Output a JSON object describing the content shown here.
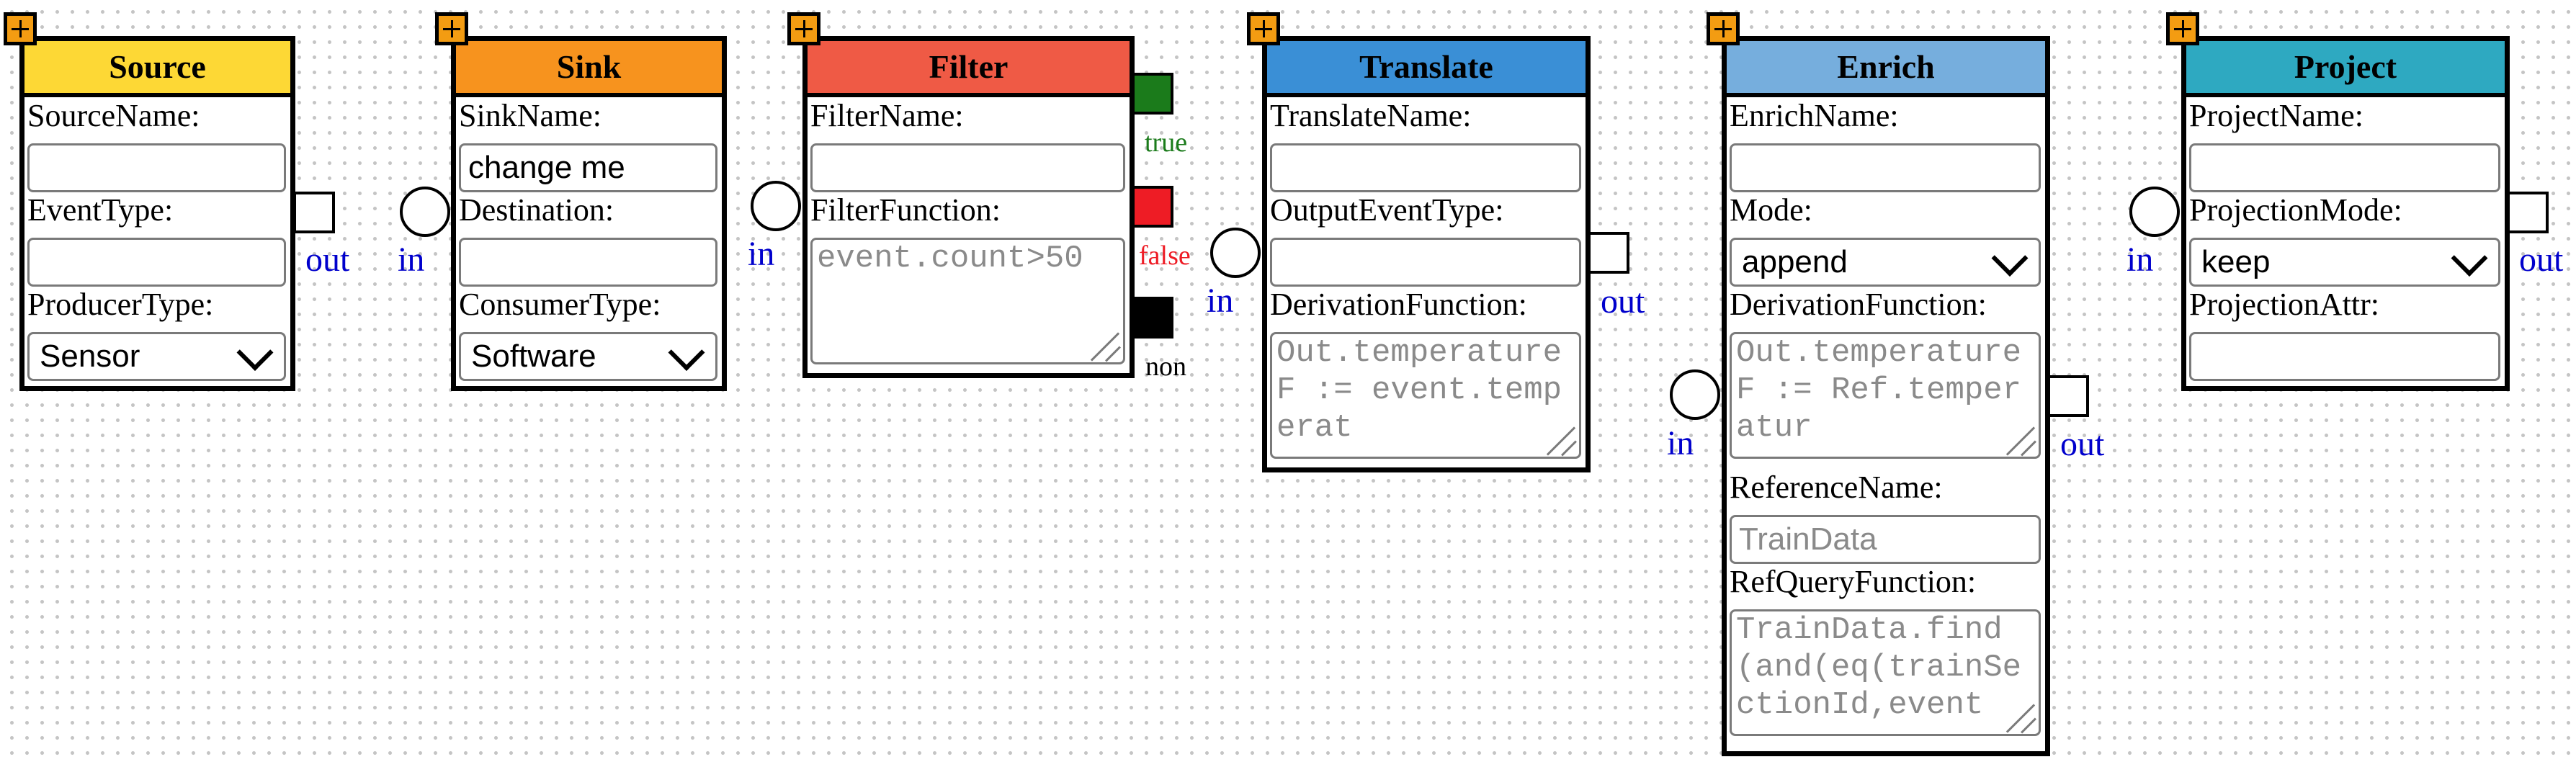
{
  "colors": {
    "source": "#fdd835",
    "sink": "#f7931e",
    "filter": "#ef5a45",
    "translate": "#3a8fd6",
    "enrich": "#76aedd",
    "project": "#2ea9c1",
    "port_label": "#0000cc",
    "true": "#1b7b1b",
    "false": "#ee1c25",
    "non": "#000000",
    "plus": "#f39c12"
  },
  "icons": [
    "plus-icon",
    "chevron-down-icon",
    "resize-grip-icon"
  ],
  "nodes": {
    "source": {
      "title": "Source",
      "labels": {
        "name": "SourceName:",
        "event_type": "EventType:",
        "producer_type": "ProducerType:"
      },
      "values": {
        "name": "",
        "event_type": "",
        "producer_type": "Sensor"
      },
      "ports": {
        "out": "out"
      }
    },
    "sink": {
      "title": "Sink",
      "labels": {
        "name": "SinkName:",
        "destination": "Destination:",
        "consumer_type": "ConsumerType:"
      },
      "values": {
        "name": "change me",
        "destination": "",
        "consumer_type": "Software"
      },
      "ports": {
        "in": "in"
      }
    },
    "filter": {
      "title": "Filter",
      "labels": {
        "name": "FilterName:",
        "function": "FilterFunction:"
      },
      "values": {
        "name": ""
      },
      "placeholders": {
        "function": "event.count>50"
      },
      "ports": {
        "in": "in",
        "true": "true",
        "false": "false",
        "non": "non"
      }
    },
    "translate": {
      "title": "Translate",
      "labels": {
        "name": "TranslateName:",
        "output_event_type": "OutputEventType:",
        "derivation": "DerivationFunction:"
      },
      "values": {
        "name": "",
        "output_event_type": ""
      },
      "placeholders": {
        "derivation": "Out.temperatureF := event.temperat"
      },
      "ports": {
        "in": "in",
        "out": "out"
      }
    },
    "enrich": {
      "title": "Enrich",
      "labels": {
        "name": "EnrichName:",
        "mode": "Mode:",
        "derivation": "DerivationFunction:",
        "reference_name": "ReferenceName:",
        "ref_query": "RefQueryFunction:"
      },
      "values": {
        "name": "",
        "mode": "append"
      },
      "placeholders": {
        "derivation": "Out.temperatureF := Ref.temperatur",
        "reference_name": "TrainData",
        "ref_query": "TrainData.find(and(eq(trainSectionId,event"
      },
      "ports": {
        "in": "in",
        "out": "out"
      }
    },
    "project": {
      "title": "Project",
      "labels": {
        "name": "ProjectName:",
        "mode": "ProjectionMode:",
        "attr": "ProjectionAttr:"
      },
      "values": {
        "name": "",
        "mode": "keep",
        "attr": ""
      },
      "ports": {
        "in": "in",
        "out": "out"
      }
    }
  }
}
